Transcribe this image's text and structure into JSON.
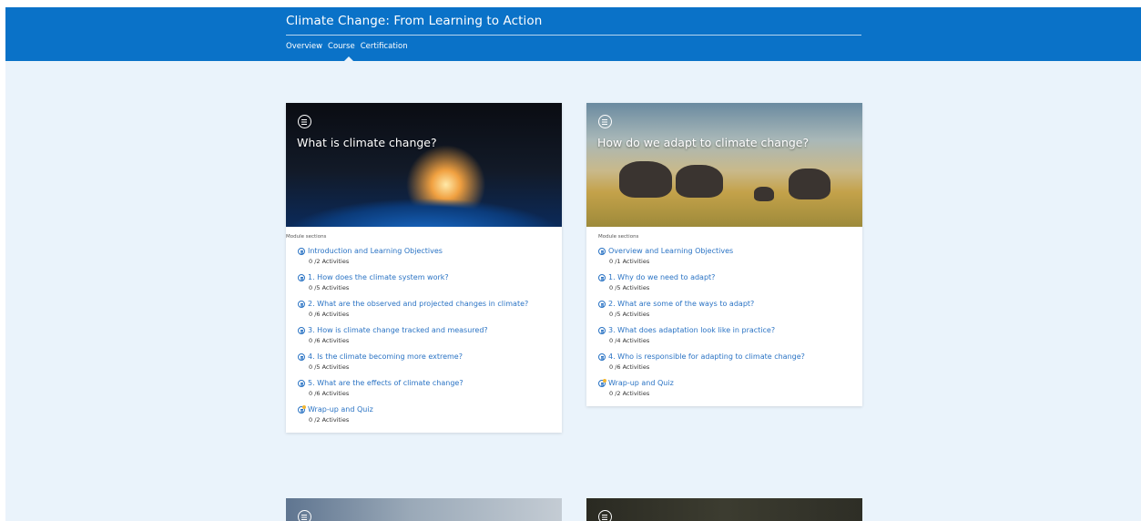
{
  "header": {
    "course_title": "Climate Change: From Learning to Action",
    "tabs": [
      "Overview",
      "Course",
      "Certification"
    ],
    "active_tab": "Course"
  },
  "modules": [
    {
      "title": "What is climate change?",
      "sections_label": "Module sections",
      "sections": [
        {
          "title": "Introduction and Learning Objectives",
          "count": "0 /2 Activities"
        },
        {
          "title": "1. How does the climate system work?",
          "count": "0 /5 Activities"
        },
        {
          "title": "2. What are the observed and projected changes in climate?",
          "count": "0 /6 Activities"
        },
        {
          "title": "3. How is climate change tracked and measured?",
          "count": "0 /6 Activities"
        },
        {
          "title": "4. Is the climate becoming more extreme?",
          "count": "0 /5 Activities"
        },
        {
          "title": "5. What are the effects of climate change?",
          "count": "0 /6 Activities"
        },
        {
          "title": "Wrap-up and Quiz",
          "count": "0 /2 Activities"
        }
      ]
    },
    {
      "title": "How do we adapt to climate change?",
      "sections_label": "Module sections",
      "sections": [
        {
          "title": "Overview and Learning Objectives",
          "count": "0 /1 Activities"
        },
        {
          "title": "1. Why do we need to adapt?",
          "count": "0 /5 Activities"
        },
        {
          "title": "2. What are some of the ways to adapt?",
          "count": "0 /5 Activities"
        },
        {
          "title": "3. What does adaptation look like in practice?",
          "count": "0 /4 Activities"
        },
        {
          "title": "4. Who is responsible for adapting to climate change?",
          "count": "0 /6 Activities"
        },
        {
          "title": "Wrap-up and Quiz",
          "count": "0 /2 Activities"
        }
      ]
    }
  ],
  "colors": {
    "header": "#0a72c8",
    "link": "#2a73c4",
    "background": "#eaf3fb"
  }
}
